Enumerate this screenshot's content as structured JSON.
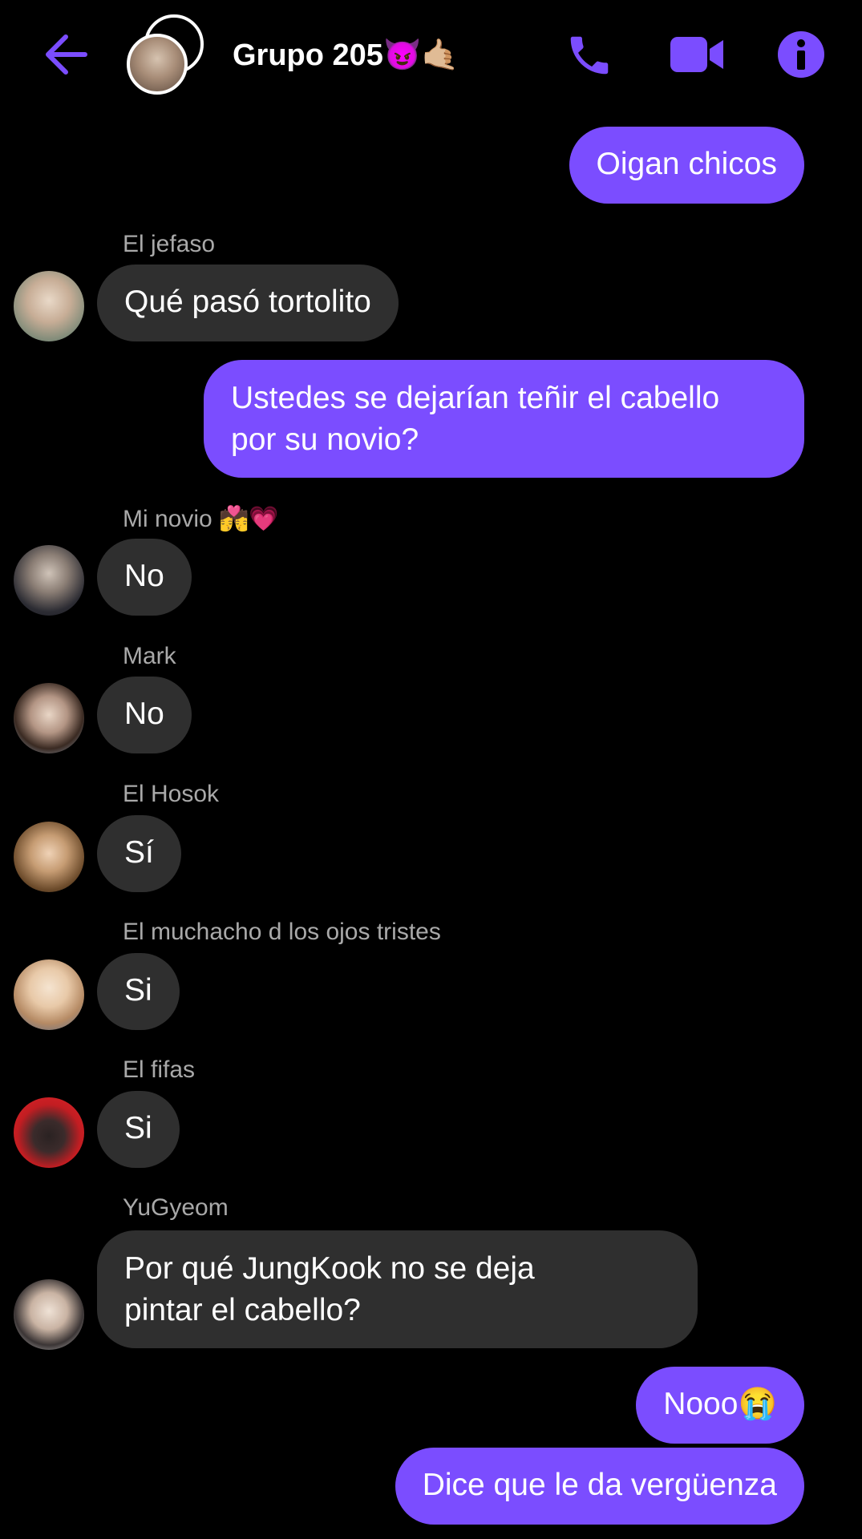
{
  "header": {
    "title": "Grupo 205",
    "title_emojis": "😈🤙🏼",
    "icons": [
      "back-arrow-icon",
      "phone-icon",
      "video-camera-icon",
      "info-icon"
    ],
    "accent_color": "#7b4dff"
  },
  "messages": [
    {
      "from": "me",
      "text": "Oigan chicos"
    },
    {
      "from": "them",
      "sender": "El jefaso",
      "text": "Qué pasó tortolito"
    },
    {
      "from": "me",
      "line1": "Ustedes se dejarían teñir el cabello",
      "line2": "por su novio?"
    },
    {
      "from": "them",
      "sender": "Mi novio",
      "sender_emojis": "💏💗",
      "text": "No"
    },
    {
      "from": "them",
      "sender": "Mark",
      "text": "No"
    },
    {
      "from": "them",
      "sender": "El Hosok",
      "text": "Sí"
    },
    {
      "from": "them",
      "sender": "El muchacho d los ojos tristes",
      "text": "Si"
    },
    {
      "from": "them",
      "sender": "El fifas",
      "text": "Si"
    },
    {
      "from": "them",
      "sender": "YuGyeom",
      "line1": "Por qué JungKook no se deja",
      "line2": "pintar el cabello?"
    },
    {
      "from": "me",
      "text": "Nooo",
      "emoji": "😭"
    },
    {
      "from": "me",
      "text": "Dice que le da vergüenza"
    }
  ]
}
